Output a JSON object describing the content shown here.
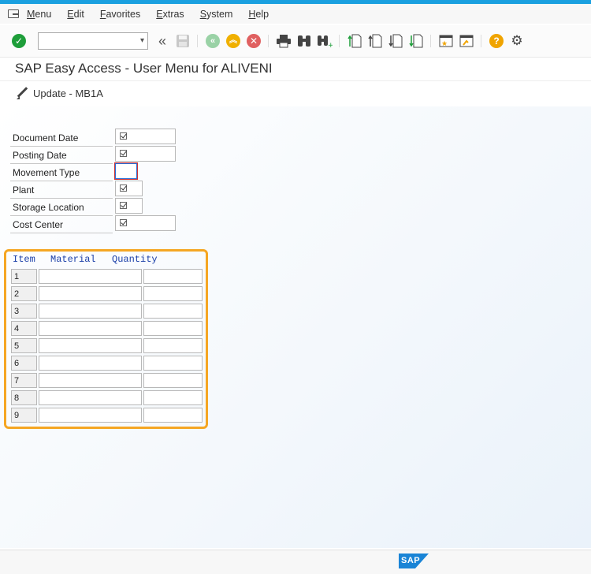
{
  "menu": {
    "items": [
      {
        "label": "Menu"
      },
      {
        "label": "Edit"
      },
      {
        "label": "Favorites"
      },
      {
        "label": "Extras"
      },
      {
        "label": "System"
      },
      {
        "label": "Help"
      }
    ]
  },
  "toolbar": {
    "command_field_value": "",
    "icons": [
      "enter-icon",
      "command-field",
      "back-nav-icon",
      "save-icon",
      "back-icon",
      "exit-icon",
      "cancel-icon",
      "print-icon",
      "find-icon",
      "find-next-icon",
      "first-page-icon",
      "previous-page-icon",
      "next-page-icon",
      "last-page-icon",
      "create-session-icon",
      "generate-shortcut-icon",
      "help-icon",
      "customize-layout-icon"
    ],
    "colors": {
      "enter": "#1e9e3a",
      "back": "#9ad2a6",
      "exit": "#f0b000",
      "cancel": "#e06060",
      "help": "#f0a400"
    }
  },
  "title": "SAP Easy Access  -  User Menu for ALIVENI",
  "app_button": {
    "label": "Update - MB1A"
  },
  "form": {
    "fields": [
      {
        "label": "Document Date",
        "checked": true
      },
      {
        "label": "Posting Date",
        "checked": true
      },
      {
        "label": "Movement Type",
        "checked": false,
        "focused": true
      },
      {
        "label": "Plant",
        "checked": true
      },
      {
        "label": "Storage Location",
        "checked": true
      },
      {
        "label": "Cost Center",
        "checked": true
      }
    ]
  },
  "table": {
    "columns": [
      "Item",
      "Material",
      "Quantity"
    ],
    "rows": [
      "1",
      "2",
      "3",
      "4",
      "5",
      "6",
      "7",
      "8",
      "9"
    ],
    "highlight_color": "#f5a623"
  },
  "status": {
    "logo": "SAP"
  }
}
